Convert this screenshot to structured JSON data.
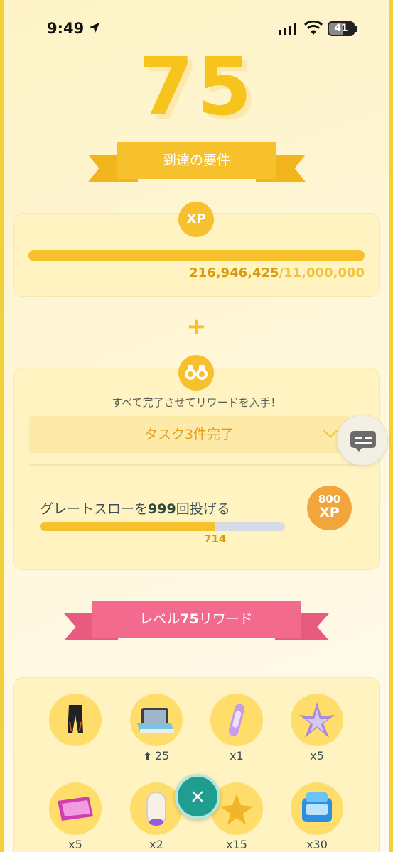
{
  "status_bar": {
    "time": "9:49",
    "battery": "41"
  },
  "level": {
    "number": "75"
  },
  "requirements": {
    "title": "到達の要件",
    "xp": {
      "badge": "XP",
      "current": "216,946,425",
      "goal": "/11,000,000",
      "progress": 1.0
    },
    "plus": "+",
    "tasks": {
      "header": "すべて完了させてリワードを入手！",
      "summary": "タスク3件完了",
      "quest": {
        "prefix": "グレートスローを",
        "count": "999",
        "suffix": "回投げる",
        "progress_value": "714",
        "progress": 0.715
      },
      "reward": {
        "amount": "800",
        "unit": "XP"
      }
    }
  },
  "rewards": {
    "title_prefix": "レベル",
    "title_level": "75",
    "title_suffix": "リワード",
    "items": [
      {
        "icon": "pants-icon",
        "qty": ""
      },
      {
        "icon": "storage-upgrade-icon",
        "qty": "25",
        "qty_icon": "arrow-up-icon"
      },
      {
        "icon": "incense-icon",
        "qty": "x1"
      },
      {
        "icon": "star-piece-icon",
        "qty": "x5"
      },
      {
        "icon": "lure-module-icon",
        "qty": "x5"
      },
      {
        "icon": "lucky-egg-icon",
        "qty": "x2"
      },
      {
        "icon": "stardust-icon",
        "qty": "x15"
      },
      {
        "icon": "max-particle-pack-icon",
        "qty": "x30"
      }
    ]
  },
  "close_button": {
    "icon": "close-icon"
  },
  "colors": {
    "gold": "#f6c12d",
    "pink": "#f26a8d",
    "teal": "#1e9d90"
  }
}
